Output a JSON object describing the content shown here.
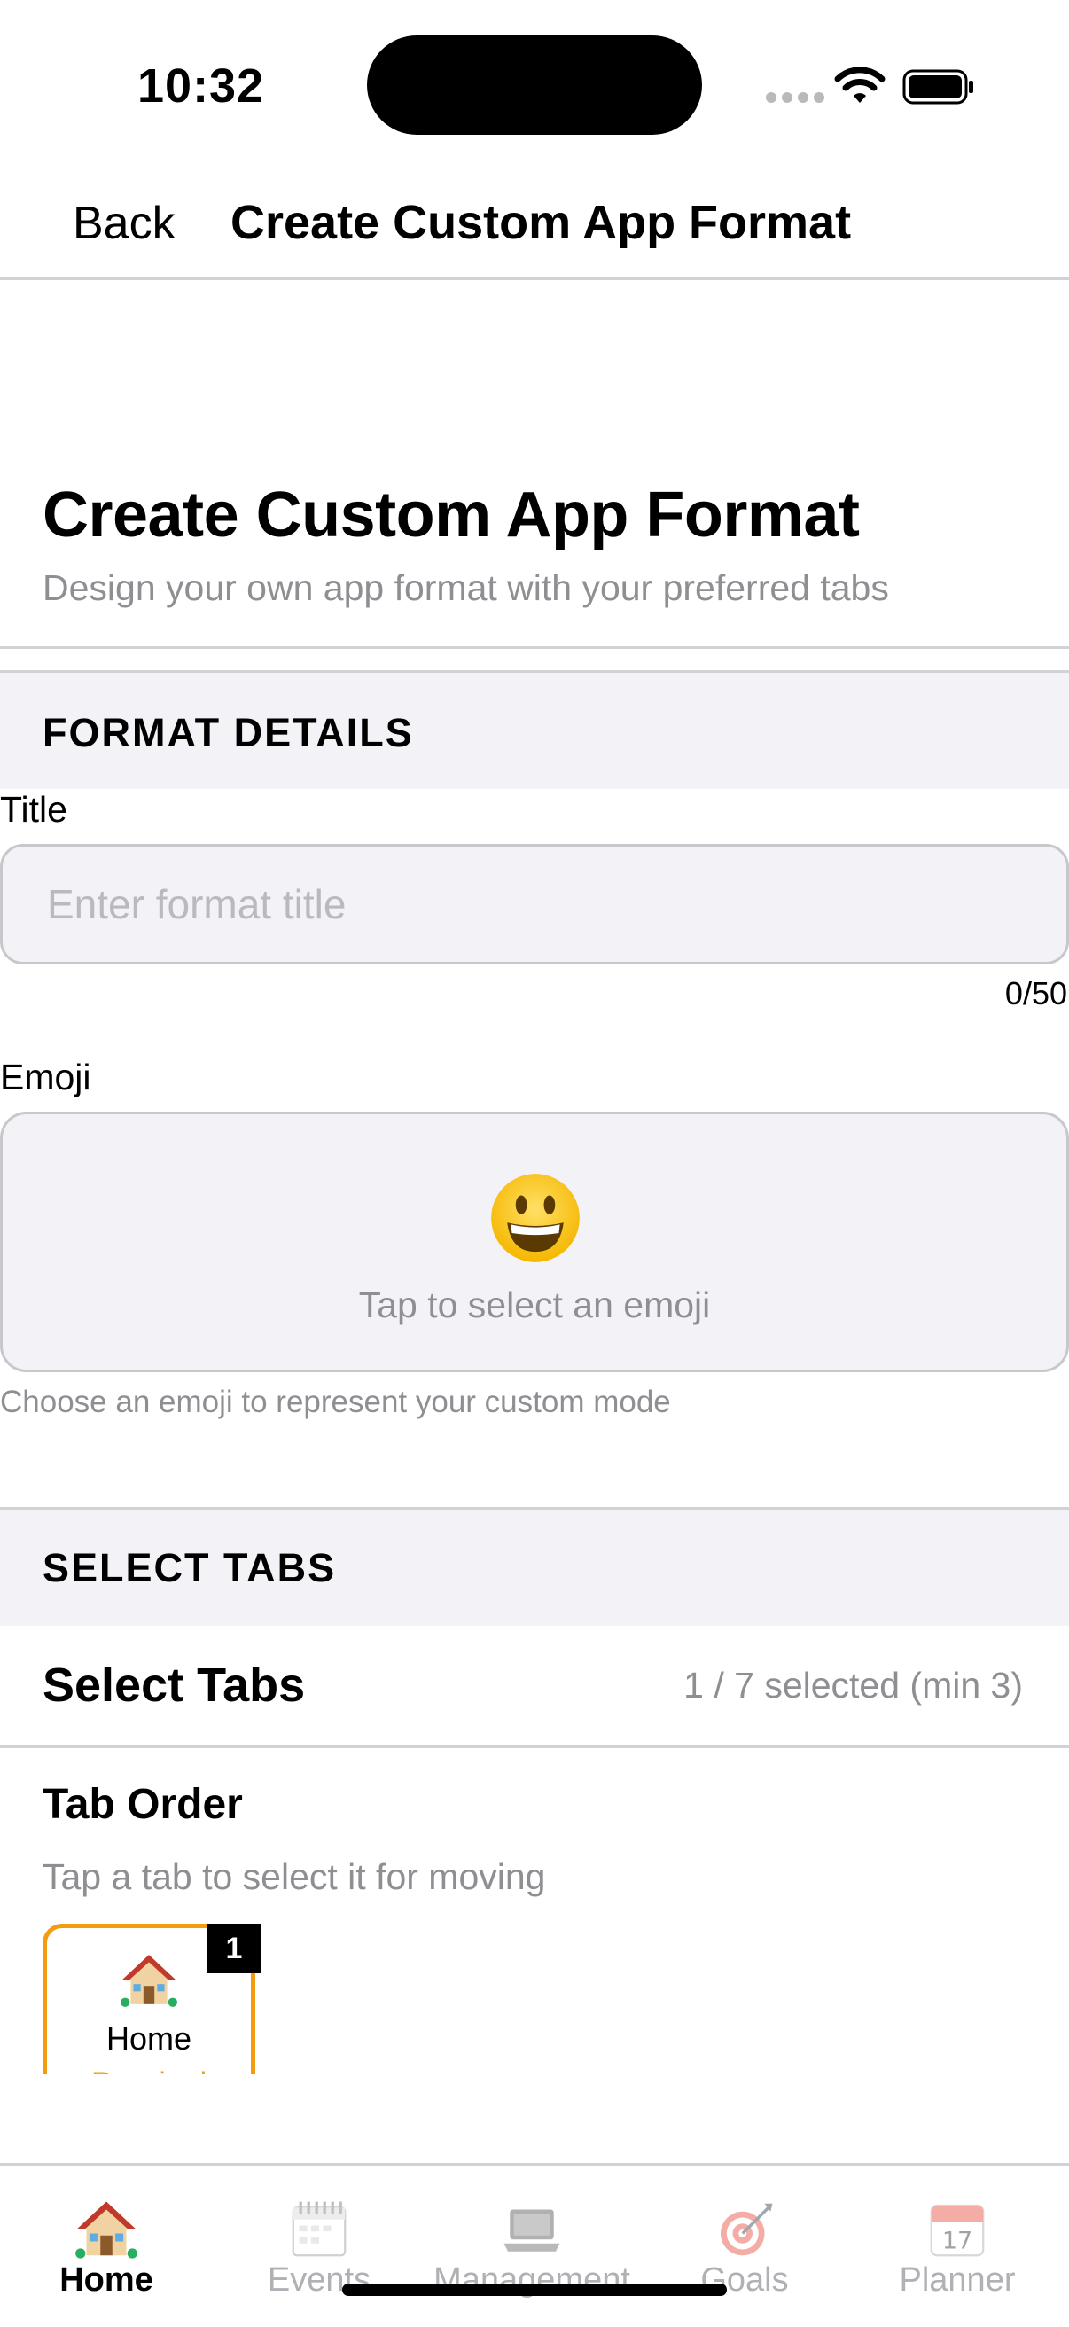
{
  "status_bar": {
    "time": "10:32",
    "icons": [
      "cellular-dots-icon",
      "wifi-icon",
      "battery-icon"
    ]
  },
  "nav": {
    "back_label": "Back",
    "title": "Create Custom App Format"
  },
  "header": {
    "title": "Create Custom App Format",
    "subtitle": "Design your own app format with your preferred tabs"
  },
  "format_details": {
    "section_label": "FORMAT DETAILS",
    "title_label": "Title",
    "title_placeholder": "Enter format title",
    "title_value": "",
    "char_count": "0/50",
    "emoji_label": "Emoji",
    "emoji_icon": "grinning-face-icon",
    "emoji_hint": "Tap to select an emoji",
    "emoji_help": "Choose an emoji to represent your custom mode"
  },
  "select_tabs": {
    "section_label": "SELECT TABS",
    "title": "Select Tabs",
    "count_text": "1 / 7 selected (min 3)",
    "tab_order_title": "Tab Order",
    "tab_order_hint": "Tap a tab to select it for moving",
    "ordered_tabs": [
      {
        "badge": "1",
        "icon": "house-icon",
        "label": "Home",
        "sub": "Required"
      }
    ]
  },
  "tab_bar": {
    "items": [
      {
        "label": "Home",
        "icon": "house-icon",
        "active": true
      },
      {
        "label": "Events",
        "icon": "calendar-icon",
        "active": false
      },
      {
        "label": "Management",
        "icon": "laptop-icon",
        "active": false
      },
      {
        "label": "Goals",
        "icon": "target-icon",
        "active": false
      },
      {
        "label": "Planner",
        "icon": "date-calendar-icon",
        "active": false
      }
    ]
  },
  "colors": {
    "accent": "#f39c12",
    "section_bg": "#f2f2f7",
    "secondary_text": "#8e8e93",
    "separator": "#d1d1d6"
  }
}
